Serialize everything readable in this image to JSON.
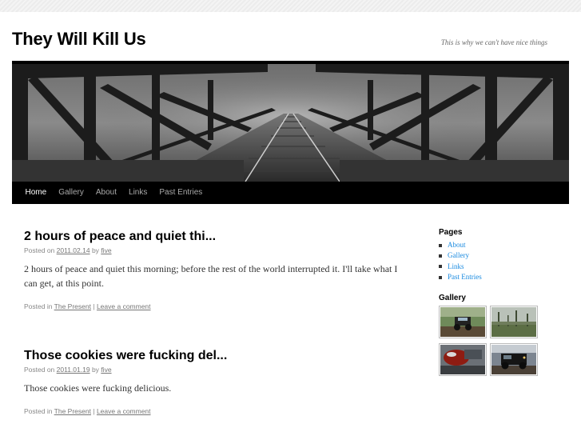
{
  "site": {
    "title": "They Will Kill Us",
    "description": "This is why we can't have nice things"
  },
  "nav": [
    {
      "label": "Home",
      "current": true
    },
    {
      "label": "Gallery",
      "current": false
    },
    {
      "label": "About",
      "current": false
    },
    {
      "label": "Links",
      "current": false
    },
    {
      "label": "Past Entries",
      "current": false
    }
  ],
  "posts": [
    {
      "title": "2 hours of peace and quiet thi...",
      "posted_on": "Posted on",
      "date": "2011.02.14",
      "by": "by",
      "author": "five",
      "body": "2 hours of peace and quiet this morning; before the rest of the world interrupted it. I'll take what I can get, at this point.",
      "posted_in": "Posted in",
      "category": "The Present",
      "separator": "|",
      "comment_link": "Leave a comment"
    },
    {
      "title": "Those cookies were fucking del...",
      "posted_on": "Posted on",
      "date": "2011.01.19",
      "by": "by",
      "author": "five",
      "body": "Those cookies were fucking delicious.",
      "posted_in": "Posted in",
      "category": "The Present",
      "separator": "|",
      "comment_link": "Leave a comment"
    }
  ],
  "sidebar": {
    "pages_title": "Pages",
    "pages": [
      "About",
      "Gallery",
      "Links",
      "Past Entries"
    ],
    "gallery_title": "Gallery"
  },
  "colors": {
    "link": "#1b8be0",
    "nav_bg": "#000000",
    "nav_text": "#aaaaaa",
    "nav_current": "#ffffff"
  }
}
